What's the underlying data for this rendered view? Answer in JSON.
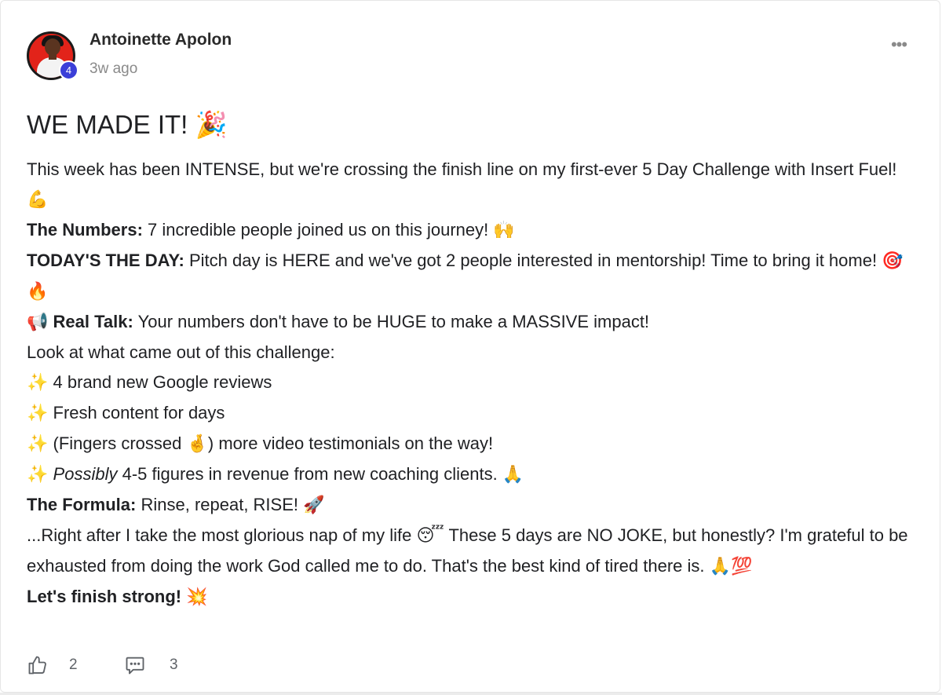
{
  "post": {
    "author": "Antoinette Apolon",
    "level": "4",
    "timestamp": "3w ago",
    "menu_label": "•••",
    "title": "WE MADE IT!",
    "title_emoji": "🎉",
    "intro": "This week has been INTENSE, but we're crossing the finish line on my first-ever 5 Day Challenge with Insert Fuel!",
    "intro_emoji": "💪",
    "numbers_label": "The Numbers:",
    "numbers_text": "7 incredible people joined us on this journey!",
    "numbers_emoji": "🙌",
    "today_label": "TODAY'S THE DAY:",
    "today_text": "Pitch day is HERE and we've got 2 people interested in mentorship! Time to bring it home!",
    "today_emoji": "🎯🔥",
    "realtalk_emoji": "📢",
    "realtalk_label": "Real Talk:",
    "realtalk_text": "Your numbers don't have to be HUGE to make a MASSIVE impact!",
    "lookat": "Look at what came out of this challenge:",
    "sparkle": "✨",
    "bullet1": "4 brand new Google reviews",
    "bullet2": "Fresh content for days",
    "bullet3_a": "(Fingers crossed",
    "bullet3_emoji": "🤞",
    "bullet3_b": ") more video testimonials on the way!",
    "bullet4_italic": "Possibly",
    "bullet4_text": "4-5 figures in revenue from new coaching clients.",
    "bullet4_emoji": "🙏",
    "formula_label": "The Formula:",
    "formula_text": "Rinse, repeat, RISE!",
    "formula_emoji": "🚀",
    "nap_text_a": "...Right after I take the most glorious nap of my life",
    "nap_emoji": "😴",
    "nap_text_b": "These 5 days are NO JOKE, but honestly? I'm grateful to be exhausted from doing the work God called me to do. That's the best kind of tired there is.",
    "nap_emoji2": "🙏💯",
    "finish": "Let's finish strong!",
    "finish_emoji": "💥"
  },
  "actions": {
    "likes": "2",
    "comments": "3"
  },
  "icons": {
    "like": "thumbs-up-icon",
    "comment": "comment-icon",
    "more": "more-options-icon"
  }
}
